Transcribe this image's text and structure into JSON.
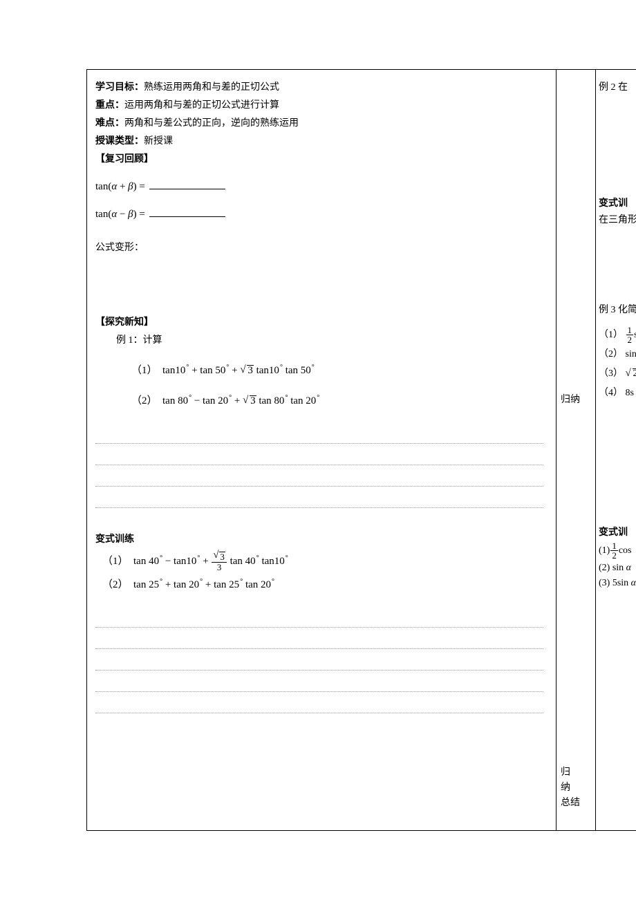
{
  "header": {
    "goal_label": "学习目标：",
    "goal_text": "熟练运用两角和与差的正切公式",
    "focus_label": "重点：",
    "focus_text": "运用两角和与差的正切公式进行计算",
    "difficulty_label": "难点：",
    "difficulty_text": "两角和与差公式的正向，逆向的熟练运用",
    "lesson_type_label": "授课类型：",
    "lesson_type_text": "新授课"
  },
  "review": {
    "heading": "【复习回顾】",
    "tan_sum": "tan(α + β) =",
    "tan_diff": "tan(α − β) =",
    "transform_label": "公式变形："
  },
  "explore": {
    "heading": "【探究新知】",
    "ex1_label": "例 1：计算",
    "ex1_item1_prefix": "（1）",
    "ex1_item1_text": "tan10° + tan50° + √3 tan10° tan50°",
    "ex1_item2_prefix": "（2）",
    "ex1_item2_text": "tan80° − tan20° + √3 tan80° tan20°"
  },
  "variant": {
    "heading": "变式训练",
    "item1_prefix": "（1）",
    "item1_text": "tan40° − tan10° + (√3/3) tan40° tan10°",
    "item2_prefix": "（2）",
    "item2_text": "tan25° + tan20° + tan25° tan20°"
  },
  "sidebar": {
    "label1": "归纳",
    "label2_a": "归　纳",
    "label2_b": "总结"
  },
  "right": {
    "ex2": "例 2 在",
    "var_heading_a": "变式训",
    "var_heading_b_text": "在三角形",
    "ex3": "例 3 化简",
    "r1_prefix": "（1）",
    "r1_frac_num": "1",
    "r1_frac_den": "2",
    "r1_tail": "s",
    "r2_prefix": "（2）",
    "r2_text": "sin",
    "r3_prefix": "（3）",
    "r3_text": "√2",
    "r4_prefix": "（4）",
    "r4_text": "8s",
    "var2_heading": "变式训",
    "b1_prefix": "(1)",
    "b1_frac_num": "1",
    "b1_frac_den": "2",
    "b1_tail": "cos",
    "b2_prefix": "(2)",
    "b2_text": "sin α",
    "b3_prefix": "(3)",
    "b3_text": "5 sin α"
  }
}
